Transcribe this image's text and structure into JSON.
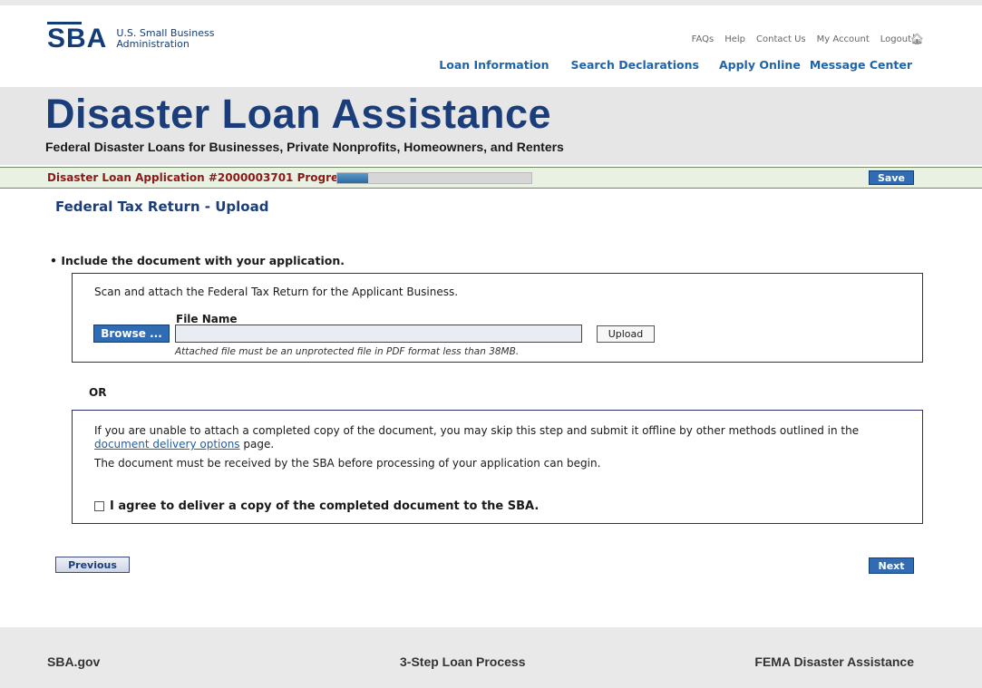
{
  "logo": {
    "mark": "SBA",
    "line1": "U.S. Small Business",
    "line2": "Administration"
  },
  "utility_nav": [
    "FAQs",
    "Help",
    "Contact Us",
    "My Account",
    "Logout"
  ],
  "main_nav": [
    "Loan Information",
    "Search Declarations",
    "Apply Online",
    "Message Center"
  ],
  "banner": {
    "title": "Disaster Loan Assistance",
    "subtitle": "Federal Disaster Loans for Businesses, Private Nonprofits, Homeowners, and Renters"
  },
  "progress": {
    "label": "Disaster Loan Application #2000003701  Progress",
    "fraction": 0.16,
    "save_label": "Save"
  },
  "page_title": "Federal Tax Return - Upload",
  "instruction": "• Include the document with your application.",
  "upload_box": {
    "text": "Scan and attach the Federal Tax Return for the Applicant Business.",
    "file_name_label": "File Name",
    "browse_label": "Browse ...",
    "upload_label": "Upload",
    "file_value": "",
    "hint": "Attached file must be an unprotected file in PDF format less than 38MB."
  },
  "or_label": "OR",
  "offline_box": {
    "para1_a": "If you are unable to attach a completed copy of the document, you may skip this step and submit it offline by other methods outlined in the ",
    "para1_link": "document delivery options",
    "para1_b": " page.",
    "para2": "The document must be received by the SBA before processing of your application can begin.",
    "agree_label": "I agree to deliver a copy of the completed document to the SBA.",
    "agree_checked": false
  },
  "nav_buttons": {
    "previous": "Previous",
    "next": "Next"
  },
  "footer": [
    "SBA.gov",
    "3-Step Loan Process",
    "FEMA Disaster Assistance"
  ]
}
